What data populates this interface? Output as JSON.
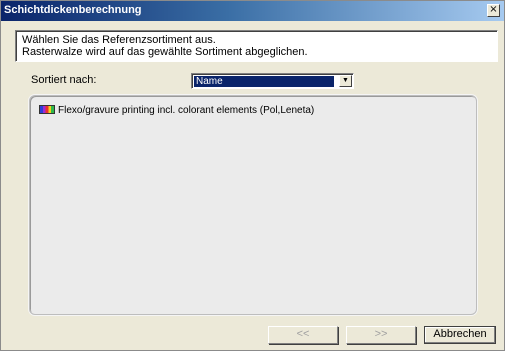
{
  "window": {
    "title": "Schichtdickenberechnung",
    "close_label": "×"
  },
  "info": {
    "line1": "Wählen Sie das Referenzsortiment aus.",
    "line2": "Rasterwalze wird auf das gewählte Sortiment abgeglichen."
  },
  "sort": {
    "label": "Sortiert nach:",
    "selected": "Name",
    "arrow_icon": "▼"
  },
  "list": {
    "items": [
      {
        "label": "Flexo/gravure printing incl. colorant elements  (Pol,Leneta)",
        "icon": "color-swatch-icon"
      }
    ]
  },
  "buttons": {
    "prev": "<<",
    "next": ">>",
    "cancel": "Abbrechen"
  },
  "colors": {
    "selection": "#0a246a",
    "dialog_bg": "#ece9d8"
  }
}
